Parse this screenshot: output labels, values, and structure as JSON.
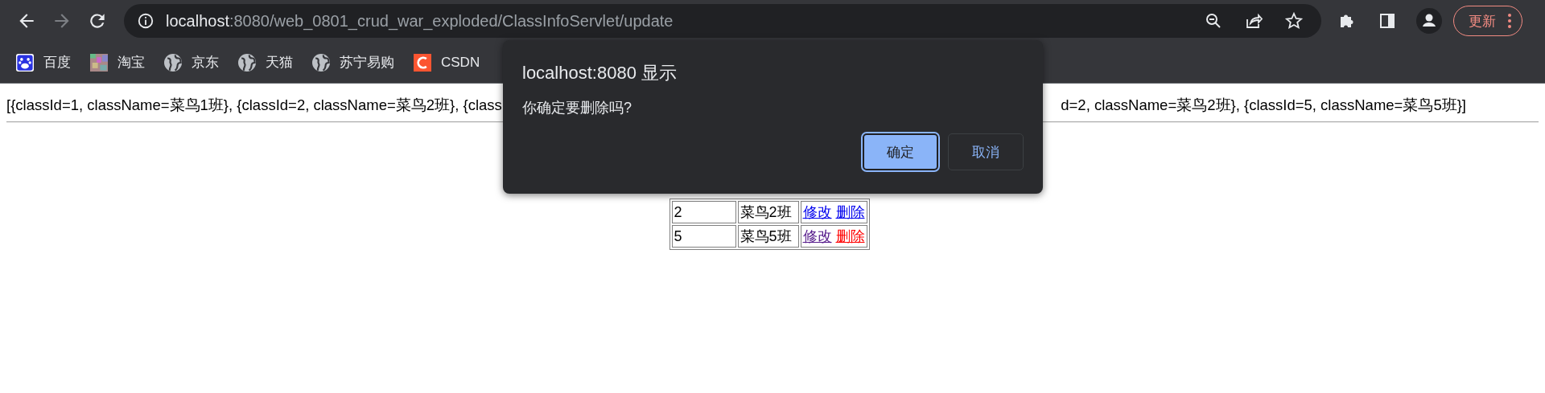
{
  "browser": {
    "nav": {
      "back_enabled": true,
      "forward_enabled": false
    },
    "url": {
      "host": "localhost",
      "rest": ":8080/web_0801_crud_war_exploded/ClassInfoServlet/update"
    },
    "update_button": "更新"
  },
  "bookmarks": [
    {
      "label": "百度",
      "kind": "paw"
    },
    {
      "label": "淘宝",
      "kind": "noise"
    },
    {
      "label": "京东",
      "kind": "globe"
    },
    {
      "label": "天猫",
      "kind": "globe"
    },
    {
      "label": "苏宁易购",
      "kind": "globe"
    },
    {
      "label": "CSDN",
      "kind": "csdn"
    }
  ],
  "page": {
    "list_text_left": "[{classId=1, className=菜鸟1班}, {classId=2, className=菜鸟2班}, {class",
    "list_text_right": "d=2, className=菜鸟2班}, {classId=5, className=菜鸟5班}]",
    "table": {
      "rows": [
        {
          "cells": [
            "2",
            "菜鸟2班"
          ],
          "links": [
            {
              "label": "修改",
              "kind": "unvisited"
            },
            {
              "label": "删除",
              "kind": "unvisited"
            }
          ]
        },
        {
          "cells": [
            "5",
            "菜鸟5班"
          ],
          "links": [
            {
              "label": "修改",
              "kind": "visited"
            },
            {
              "label": "删除",
              "kind": "active"
            }
          ]
        }
      ]
    }
  },
  "dialog": {
    "title": "localhost:8080 显示",
    "message": "你确定要删除吗?",
    "buttons": [
      {
        "label": "确定",
        "selected": true
      },
      {
        "label": "取消",
        "selected": false
      }
    ]
  }
}
